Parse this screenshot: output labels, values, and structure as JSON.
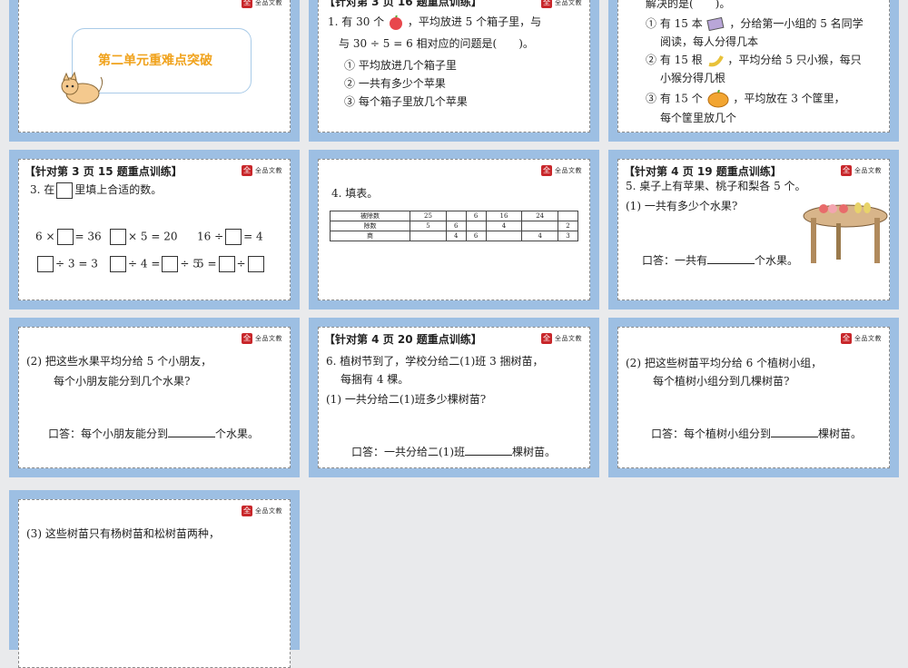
{
  "slides": {
    "s1": {
      "title": "第二单元重难点突破"
    },
    "s2": {
      "header": "【针对第 3 页 16 题重点训练】",
      "q1a": "1. 有 30 个",
      "q1b": "，平均放进 5 个箱子里，与",
      "q1c": "与 30 ÷ 5 = 6 相对应的问题是(　　)。",
      "opt1": "① 平均放进几个箱子里",
      "opt2": "② 一共有多少个苹果",
      "opt3": "③ 每个箱子里放几个苹果"
    },
    "s3": {
      "l0": "解决的是(　　)。",
      "l1a": "① 有 15 本",
      "l1b": "，分给第一小组的 5 名同学",
      "l1c": "阅读，每人分得几本",
      "l2a": "② 有 15 根",
      "l2b": "，平均分给 5 只小猴，每只",
      "l2c": "小猴分得几根",
      "l3a": "③ 有 15 个",
      "l3b": "，平均放在 3 个筐里，",
      "l3c": "每个筐里放几个"
    },
    "s4": {
      "header": "【针对第 3 页 15 题重点训练】",
      "q": "3. 在",
      "q2": "里填上合适的数。",
      "e1a": "6 ×",
      "e1b": "= 36",
      "e2b": "× 5 = 20",
      "e3a": "16 ÷",
      "e3b": "= 4",
      "e4b": "÷ 3 = 3",
      "e5b": "÷ 4 =",
      "e5c": "÷ 5",
      "e6a": "5 =",
      "e6b": "÷"
    },
    "s5": {
      "q": "4. 填表。",
      "rows": [
        [
          "被除数",
          "25",
          "",
          "6",
          "16",
          "24",
          ""
        ],
        [
          "除数",
          "5",
          "6",
          "",
          "4",
          "",
          "2"
        ],
        [
          "商",
          "",
          "4",
          "6",
          "",
          "4",
          "3"
        ]
      ]
    },
    "s6": {
      "header": "【针对第 4 页 19 题重点训练】",
      "q": "5. 桌子上有苹果、桃子和梨各 5 个。",
      "sub": "(1) 一共有多少个水果?",
      "ans_a": "口答：一共有",
      "ans_b": "个水果。"
    },
    "s7": {
      "l1": "(2) 把这些水果平均分给 5 个小朋友，",
      "l2": "每个小朋友能分到几个水果?",
      "ans_a": "口答：每个小朋友能分到",
      "ans_b": "个水果。"
    },
    "s8": {
      "header": "【针对第 4 页 20 题重点训练】",
      "l1": "6. 植树节到了，学校分给二(1)班 3 捆树苗，",
      "l2": "每捆有 4 棵。",
      "l3": "(1) 一共分给二(1)班多少棵树苗?",
      "ans_a": "口答：一共分给二(1)班",
      "ans_b": "棵树苗。"
    },
    "s9": {
      "l1": "(2) 把这些树苗平均分给 6 个植树小组，",
      "l2": "每个植树小组分到几棵树苗?",
      "ans_a": "口答：每个植树小组分到",
      "ans_b": "棵树苗。"
    },
    "s10": {
      "l1": "(3) 这些树苗只有杨树苗和松树苗两种，"
    }
  },
  "logo_text": "全品文教",
  "colors": {
    "frame": "#9dbfe3",
    "title": "#f0a21c",
    "bg": "#e9eaec"
  }
}
